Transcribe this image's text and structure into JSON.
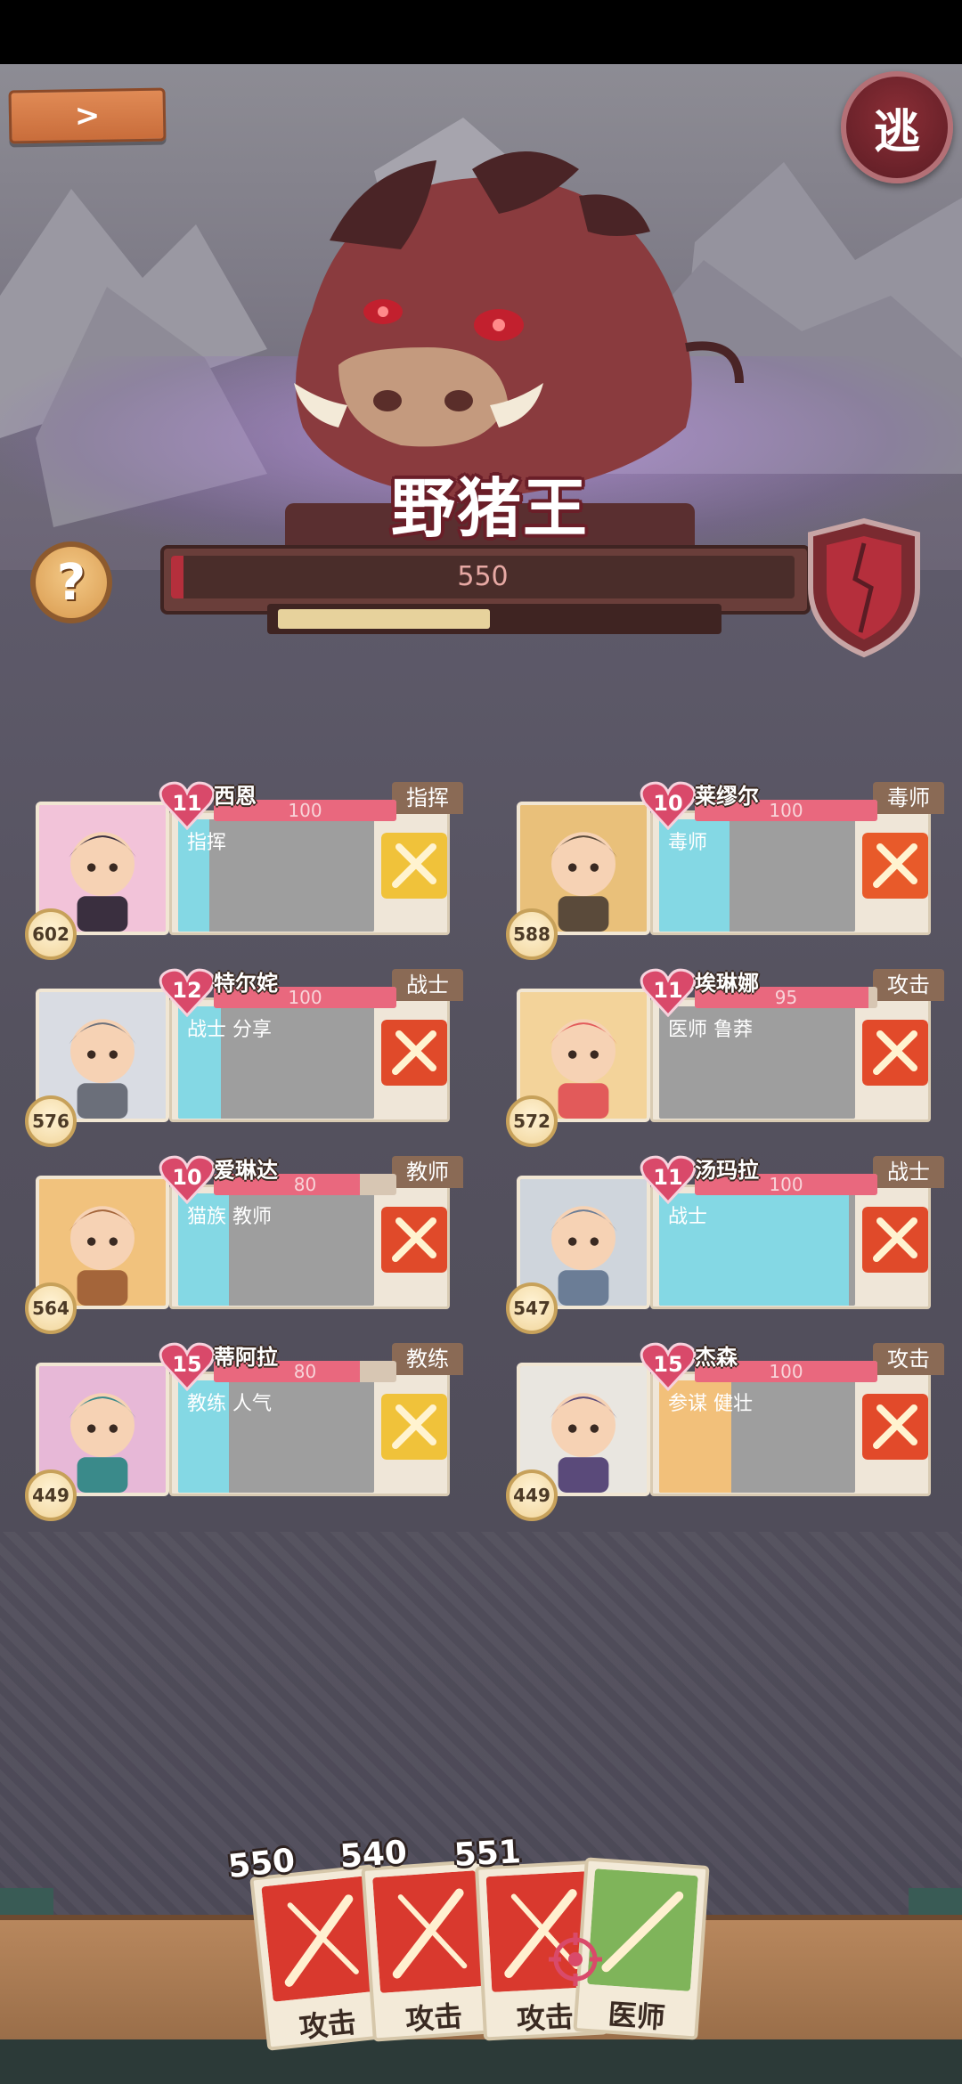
{
  "top_bar": {
    "back_label": ">",
    "flee_label": "逃"
  },
  "boss": {
    "name": "野猪王",
    "hp_value": "550",
    "hp_fraction": 0.02,
    "shield_fraction": 0.49,
    "help_label": "?"
  },
  "party": [
    {
      "name": "西恩",
      "level": "11",
      "hp": "100",
      "hp_fraction": 1.0,
      "role": "指挥",
      "skills": "指挥",
      "skill_fill": 0.16,
      "power": "602",
      "role_color": "#f0c23a"
    },
    {
      "name": "莱缪尔",
      "level": "10",
      "hp": "100",
      "hp_fraction": 1.0,
      "role": "毒师",
      "skills": "毒师",
      "skill_fill": 0.36,
      "power": "588",
      "role_color": "#e85a2a"
    },
    {
      "name": "特尔姹",
      "level": "12",
      "hp": "100",
      "hp_fraction": 1.0,
      "role": "战士",
      "skills": "战士 分享",
      "skill_fill": 0.22,
      "power": "576",
      "role_color": "#e04a2a"
    },
    {
      "name": "埃琳娜",
      "level": "11",
      "hp": "95",
      "hp_fraction": 0.95,
      "role": "攻击",
      "skills": "医师 鲁莽",
      "skill_fill": 0.0,
      "power": "572",
      "role_color": "#e24a2a"
    },
    {
      "name": "爱琳达",
      "level": "10",
      "hp": "80",
      "hp_fraction": 0.8,
      "role": "教师",
      "skills": "猫族 教师",
      "skill_fill": 0.26,
      "power": "564",
      "role_color": "#e04a2a"
    },
    {
      "name": "汤玛拉",
      "level": "11",
      "hp": "100",
      "hp_fraction": 1.0,
      "role": "战士",
      "skills": "战士",
      "skill_fill": 0.97,
      "power": "547",
      "role_color": "#e04a2a"
    },
    {
      "name": "蒂阿拉",
      "level": "15",
      "hp": "80",
      "hp_fraction": 0.8,
      "role": "教练",
      "skills": "教练 人气",
      "skill_fill": 0.26,
      "power": "449",
      "role_color": "#f0c23a"
    },
    {
      "name": "杰森",
      "level": "15",
      "hp": "100",
      "hp_fraction": 1.0,
      "role": "攻击",
      "skills": "参谋 健壮",
      "skill_fill": 0.37,
      "power": "449",
      "role_color": "#e24a2a"
    }
  ],
  "hand": [
    {
      "label": "攻击",
      "cost": "550",
      "kind": "attack"
    },
    {
      "label": "攻击",
      "cost": "540",
      "kind": "attack"
    },
    {
      "label": "攻击",
      "cost": "551",
      "kind": "attack"
    },
    {
      "label": "医师",
      "cost": "",
      "kind": "heal"
    }
  ],
  "colors": {
    "boss_hp": "#b52f3c",
    "member_hp": "#e9687e",
    "skill_fill": "#84d8e4",
    "skill_fill_alt": "#f2c07a"
  }
}
